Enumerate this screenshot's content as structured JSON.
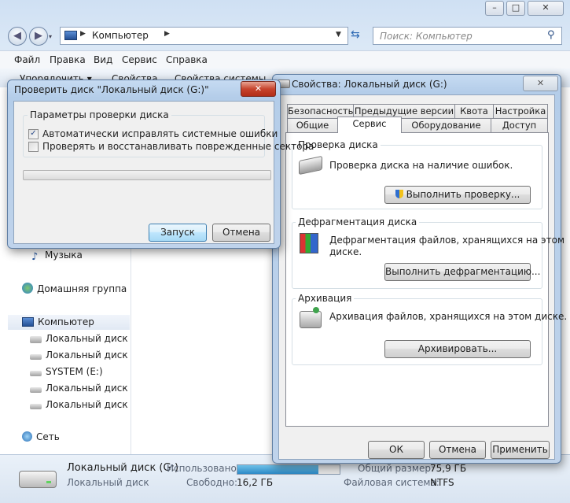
{
  "explorer": {
    "address": "Компьютер",
    "search_placeholder": "Поиск: Компьютер",
    "menu": [
      "Файл",
      "Правка",
      "Вид",
      "Сервис",
      "Справка"
    ],
    "commands": [
      "Упорядочить ▾",
      "Свойства",
      "Свойства системы"
    ],
    "nav": {
      "music": "Музыка",
      "homegroup": "Домашняя группа",
      "computer": "Компьютер",
      "drives": [
        "Локальный диск (C",
        "Локальный диск (D",
        "SYSTEM (E:)",
        "Локальный диск (F:",
        "Локальный диск (G"
      ],
      "network": "Сеть"
    },
    "details": {
      "name": "Локальный диск (G:)",
      "type": "Локальный диск",
      "used_label": "Использовано:",
      "free_label": "Свободно:",
      "free_value": "16,2 ГБ",
      "total_label": "Общий размер:",
      "total_value": "75,9 ГБ",
      "fs_label": "Файловая система:",
      "fs_value": "NTFS",
      "used_fraction": 0.79
    }
  },
  "checkdisk": {
    "title": "Проверить диск \"Локальный диск (G:)\"",
    "group_title": "Параметры проверки диска",
    "option1": "Автоматически исправлять системные ошибки",
    "option1_checked": true,
    "option2": "Проверять и восстанавливать поврежденные сектора",
    "option2_checked": false,
    "start_button": "Запуск",
    "cancel_button": "Отмена"
  },
  "properties": {
    "title": "Свойства: Локальный диск (G:)",
    "tabs_row1": [
      "Безопасность",
      "Предыдущие версии",
      "Квота",
      "Настройка"
    ],
    "tabs_row2": [
      "Общие",
      "Сервис",
      "Оборудование",
      "Доступ"
    ],
    "active_tab": "Сервис",
    "check_group": "Проверка диска",
    "check_text": "Проверка диска на наличие ошибок.",
    "check_button": "Выполнить проверку...",
    "defrag_group": "Дефрагментация диска",
    "defrag_text_line1": "Дефрагментация файлов, хранящихся на этом",
    "defrag_text_line2": "диске.",
    "defrag_button": "Выполнить дефрагментацию...",
    "backup_group": "Архивация",
    "backup_text": "Архивация файлов, хранящихся на этом диске.",
    "backup_button": "Архивировать...",
    "ok_button": "ОК",
    "cancel_button": "Отмена",
    "apply_button": "Применить"
  }
}
